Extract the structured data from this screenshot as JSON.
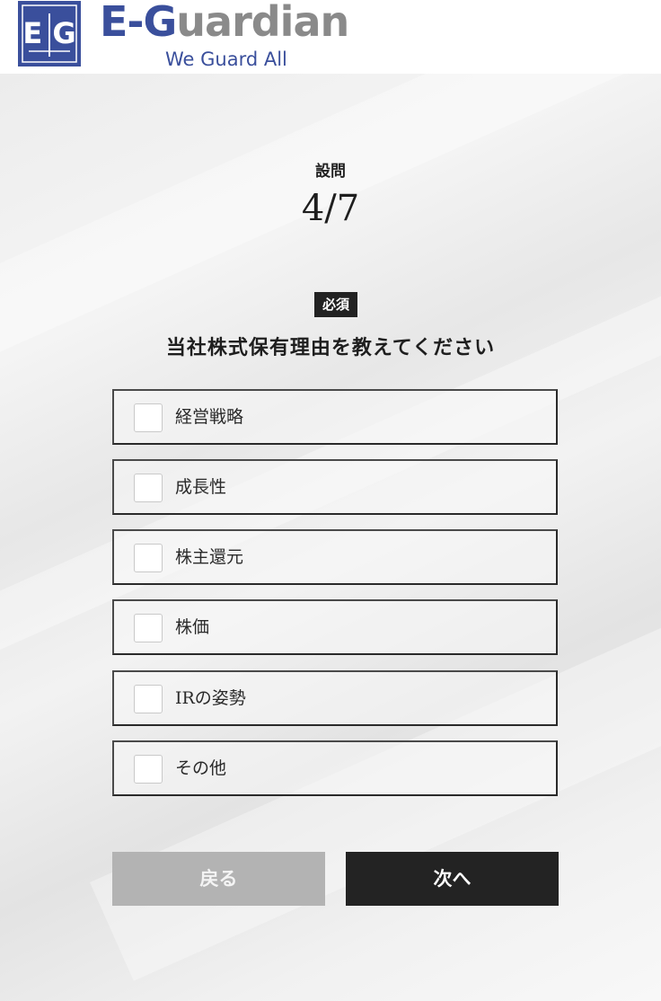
{
  "header": {
    "logo_text": "E|G",
    "brand_prefix": "E-G",
    "brand_suffix": "uardian",
    "tagline": "We Guard All"
  },
  "survey": {
    "question_label": "設問",
    "progress": "4/7",
    "required_badge": "必須",
    "question_text": "当社株式保有理由を教えてください",
    "options": [
      {
        "label": "経営戦略",
        "checked": false
      },
      {
        "label": "成長性",
        "checked": false
      },
      {
        "label": "株主還元",
        "checked": false
      },
      {
        "label": "株価",
        "checked": false
      },
      {
        "label": "IRの姿勢",
        "checked": false
      },
      {
        "label": "その他",
        "checked": false
      }
    ]
  },
  "buttons": {
    "back_label": "戻る",
    "next_label": "次へ"
  },
  "colors": {
    "brand_blue": "#3a4f9c",
    "brand_gray": "#8a8a8a",
    "button_dark": "#232323",
    "button_disabled": "#b3b3b3"
  }
}
